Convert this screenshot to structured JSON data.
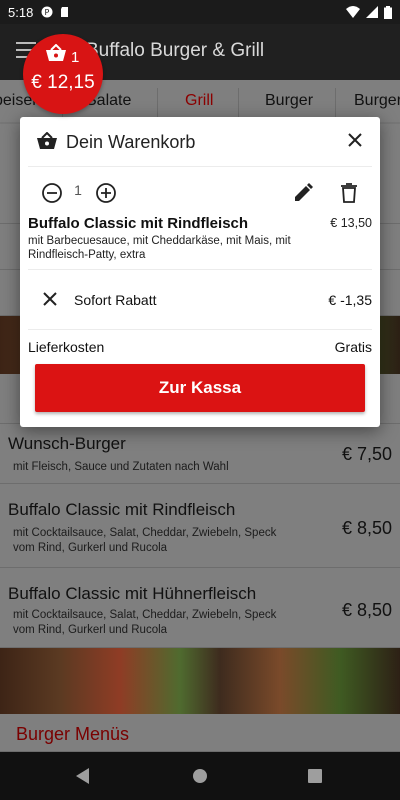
{
  "statusbar": {
    "time": "5:18"
  },
  "appbar": {
    "title": "Buffalo Burger & Grill"
  },
  "tabs": [
    "peisen",
    "Salate",
    "Grill",
    "Burger",
    "Burger"
  ],
  "cart_bubble": {
    "count": "1",
    "total": "€ 12,15"
  },
  "background": {
    "items": [
      {
        "title": "Wunsch-Burger",
        "desc": "mit Fleisch, Sauce und Zutaten nach Wahl",
        "price": "€ 7,50"
      },
      {
        "title": "Buffalo Classic mit Rindfleisch",
        "desc": "mit Cocktailsauce, Salat, Cheddar, Zwiebeln, Speck vom Rind, Gurkerl und Rucola",
        "price": "€ 8,50"
      },
      {
        "title": "Buffalo Classic mit Hühnerfleisch",
        "desc": "mit Cocktailsauce, Salat, Cheddar, Zwiebeln, Speck vom Rind, Gurkerl und Rucola",
        "price": "€ 8,50"
      }
    ],
    "section_head": "Burger Menüs"
  },
  "cart": {
    "title": "Dein Warenkorb",
    "quantity": "1",
    "item": {
      "name": "Buffalo Classic mit Rindfleisch",
      "price": "€ 13,50",
      "desc": "mit Barbecuesauce, mit Cheddarkäse, mit Mais, mit Rindfleisch-Patty, extra"
    },
    "rabatt_label": "Sofort Rabatt",
    "rabatt_value": "€ -1,35",
    "liefer_label": "Lieferkosten",
    "liefer_value": "Gratis",
    "checkout_label": "Zur Kassa"
  },
  "colors": {
    "accent": "#db1313",
    "bubble": "#d81414",
    "appbar": "#202020",
    "active_tab": "#8c0000"
  }
}
